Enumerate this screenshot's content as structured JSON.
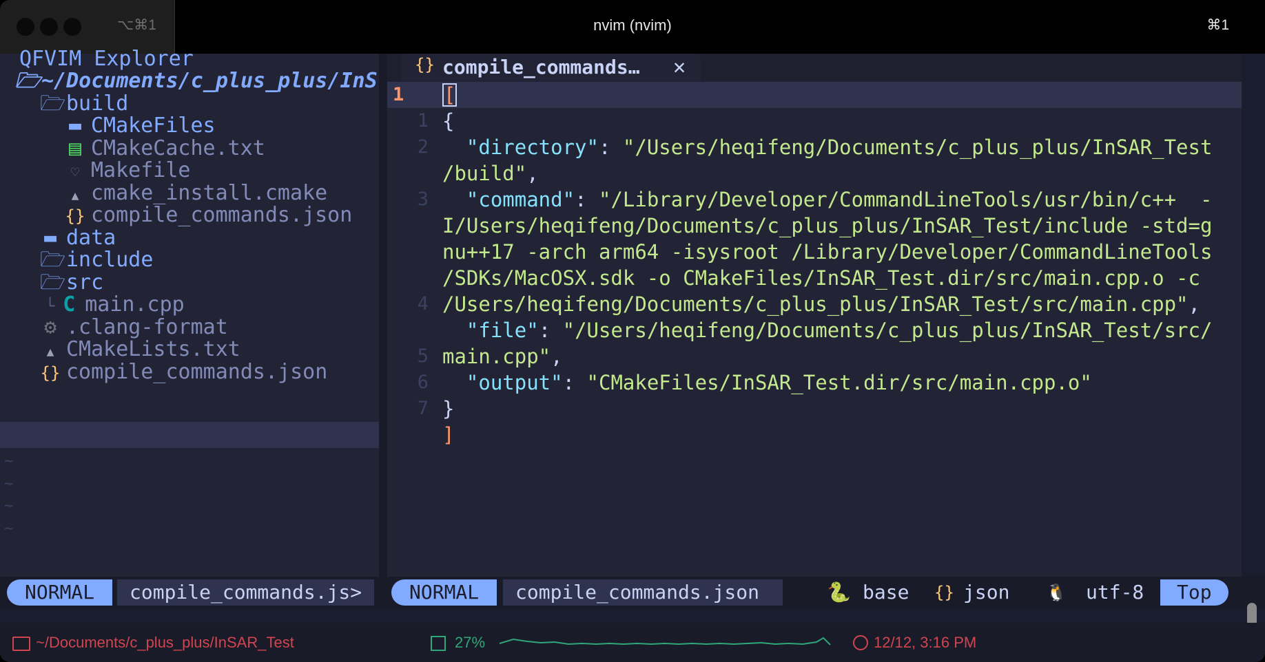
{
  "titlebar": {
    "tab_shortcut_left": "⌥⌘1",
    "title": "nvim (nvim)",
    "tab_shortcut_right": "⌘1"
  },
  "explorer": {
    "title": "QFVIM Explorer",
    "root": "~/Documents/c_plus_plus/InS",
    "items": [
      {
        "label": "build",
        "icon": "folder-open-icon"
      },
      {
        "label": "CMakeFiles",
        "icon": "folder-icon"
      },
      {
        "label": "CMakeCache.txt",
        "icon": "file-text-icon"
      },
      {
        "label": "Makefile",
        "icon": "makefile-icon"
      },
      {
        "label": "cmake_install.cmake",
        "icon": "cmake-icon"
      },
      {
        "label": "compile_commands.json",
        "icon": "json-icon"
      },
      {
        "label": "data",
        "icon": "folder-icon"
      },
      {
        "label": "include",
        "icon": "folder-open-icon"
      },
      {
        "label": "src",
        "icon": "folder-open-icon"
      },
      {
        "label": "main.cpp",
        "icon": "cpp-icon"
      },
      {
        "label": ".clang-format",
        "icon": "gear-icon"
      },
      {
        "label": "CMakeLists.txt",
        "icon": "cmake-icon"
      },
      {
        "label": "compile_commands.json",
        "icon": "json-icon"
      }
    ]
  },
  "editor": {
    "tab_icon": "{}",
    "tab_name": "compile_commands…",
    "gutter": [
      "1",
      "1",
      "2",
      "",
      "3",
      "",
      "",
      "",
      "",
      "4",
      "",
      "5",
      "6",
      "7"
    ],
    "lines": {
      "l1": "[",
      "l2": "{",
      "l3_key": "\"directory\"",
      "l3_val": "\"/Users/heqifeng/Documents/c_plus_plus/InSAR_Test",
      "l3b": "/build\"",
      "l4_key": "\"command\"",
      "l4_val": "\"/Library/Developer/CommandLineTools/usr/bin/c++  -",
      "l4b": "I/Users/heqifeng/Documents/c_plus_plus/InSAR_Test/include -std=g",
      "l4c": "nu++17 -arch arm64 -isysroot /Library/Developer/CommandLineTools",
      "l4d": "/SDKs/MacOSX.sdk -o CMakeFiles/InSAR_Test.dir/src/main.cpp.o -c",
      "l4e": "/Users/heqifeng/Documents/c_plus_plus/InSAR_Test/src/main.cpp\"",
      "l5_key": "\"file\"",
      "l5_val": "\"/Users/heqifeng/Documents/c_plus_plus/InSAR_Test/src/",
      "l5b": "main.cpp\"",
      "l6_key": "\"output\"",
      "l6_val": "\"CMakeFiles/InSAR_Test.dir/src/main.cpp.o\"",
      "l7": "}",
      "l8": "]"
    }
  },
  "statusline": {
    "left_mode": "NORMAL",
    "left_file": "compile_commands.js>",
    "mode": "NORMAL",
    "file": "compile_commands.json",
    "env": "base",
    "filetype_icon": "{}",
    "filetype": "json",
    "encoding": "utf-8",
    "position": "Top"
  },
  "bottombar": {
    "path": "~/Documents/c_plus_plus/InSAR_Test",
    "cpu": "27%",
    "datetime": "12/12, 3:16 PM"
  },
  "colors": {
    "accent": "#82aaff",
    "string": "#c3e88d",
    "key": "#86e1fc",
    "bracket": "#ff966c",
    "status_red": "#d0454f",
    "cpu_green": "#2fa77a"
  }
}
